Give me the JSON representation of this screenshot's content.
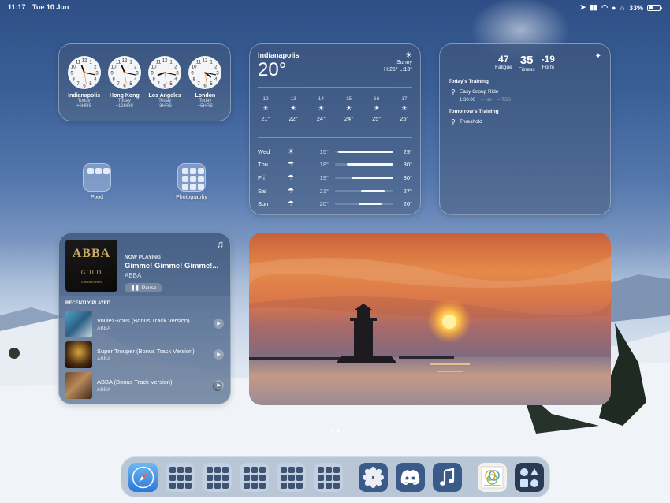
{
  "status": {
    "time": "11:17",
    "date": "Tue 10 Jun",
    "battery": "33%"
  },
  "clocks": [
    {
      "city": "Indianapolis",
      "day": "Today",
      "offset": "+0HRS"
    },
    {
      "city": "Hong Kong",
      "day": "Today",
      "offset": "+12HRS"
    },
    {
      "city": "Los Angeles",
      "day": "Today",
      "offset": "-3HRS"
    },
    {
      "city": "London",
      "day": "Today",
      "offset": "+5HRS"
    }
  ],
  "weather": {
    "city": "Indianapolis",
    "temp": "20°",
    "condition": "Sunny",
    "hilo": "H:25° L:13°",
    "hourly": [
      {
        "hour": "12",
        "icon": "sun-icon",
        "temp": "21°"
      },
      {
        "hour": "13",
        "icon": "sun-icon",
        "temp": "22°"
      },
      {
        "hour": "14",
        "icon": "sun-icon",
        "temp": "24°"
      },
      {
        "hour": "15",
        "icon": "sun-icon",
        "temp": "24°"
      },
      {
        "hour": "16",
        "icon": "sun-icon",
        "temp": "25°"
      },
      {
        "hour": "17",
        "icon": "sun-icon",
        "temp": "25°"
      }
    ],
    "daily": [
      {
        "day": "Wed",
        "icon": "sun-icon",
        "low": "15°",
        "high": "29°"
      },
      {
        "day": "Thu",
        "icon": "cloud-rain-icon",
        "low": "18°",
        "high": "30°"
      },
      {
        "day": "Fri",
        "icon": "cloud-rain-icon",
        "low": "19°",
        "high": "30°"
      },
      {
        "day": "Sat",
        "icon": "cloud-rain-icon",
        "low": "21°",
        "high": "27°"
      },
      {
        "day": "Sun",
        "icon": "cloud-rain-icon",
        "low": "20°",
        "high": "26°"
      }
    ]
  },
  "training": {
    "fatigue": {
      "value": "47",
      "label": "Fatigue"
    },
    "fitness": {
      "value": "35",
      "label": "Fitness"
    },
    "form": {
      "value": "-19",
      "label": "Form"
    },
    "today_label": "Today's Training",
    "today_workout": "Easy Group Ride",
    "today_duration": "1:30:00",
    "today_km": "-- km",
    "today_tss": "-- TSS",
    "tomorrow_label": "Tomorrow's Training",
    "tomorrow_workout": "Threshold"
  },
  "folders": [
    {
      "label": "Food"
    },
    {
      "label": "Photography"
    }
  ],
  "music": {
    "album_band": "ABBA",
    "album_name": "GOLD",
    "album_sub": "GREATEST HITS",
    "now_playing_label": "NOW PLAYING",
    "title": "Gimme! Gimme! Gimme!...",
    "artist": "ABBA",
    "pause_label": "Pause",
    "recent_label": "RECENTLY PLAYED",
    "recent": [
      {
        "title": "Voulez-Vous (Bonus Track Version)",
        "artist": "ABBA"
      },
      {
        "title": "Super Trouper (Bonus Track Version)",
        "artist": "ABBA"
      },
      {
        "title": "ABBA (Bonus Track Version)",
        "artist": "ABBA"
      }
    ]
  }
}
